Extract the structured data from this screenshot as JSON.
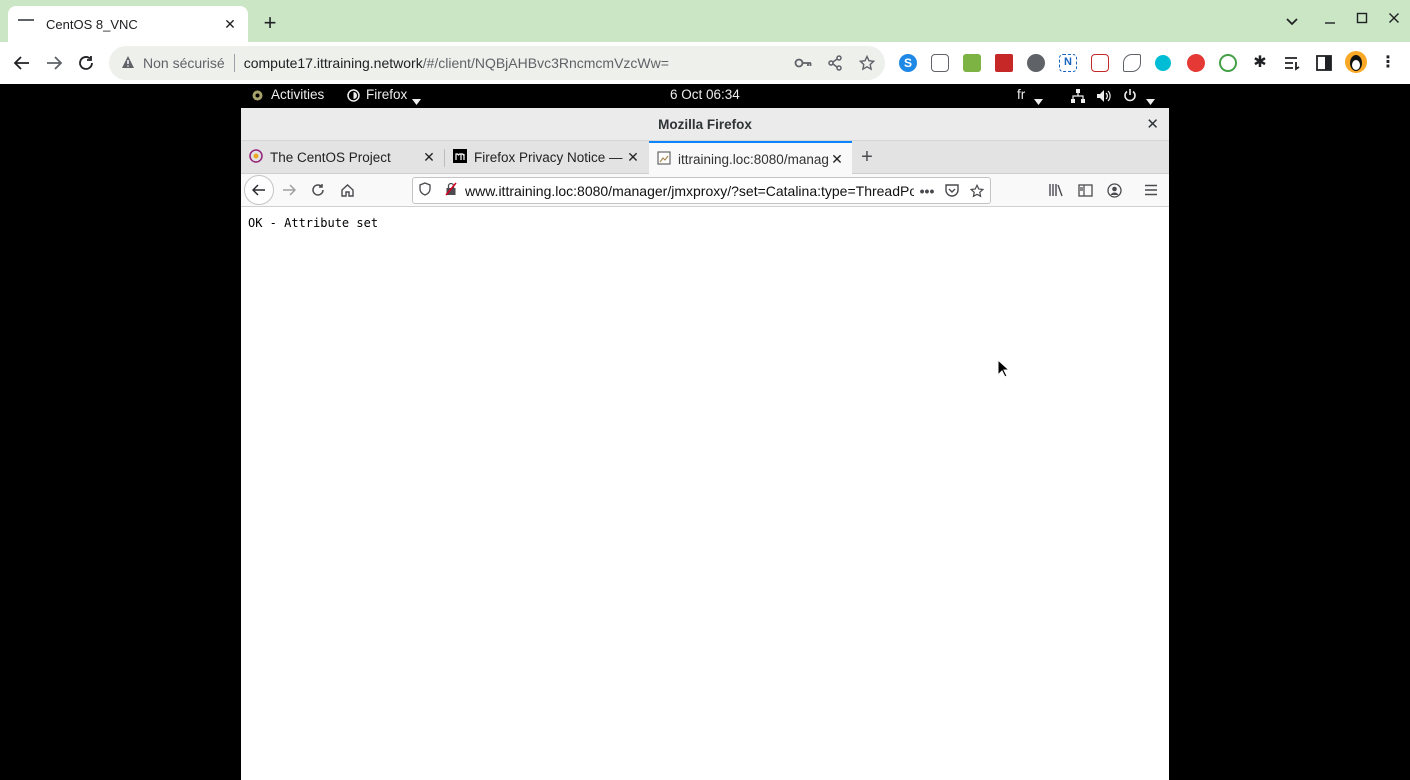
{
  "chrome": {
    "tab_title": "CentOS 8_VNC",
    "security_label": "Non sécurisé",
    "url_host": "compute17.ittraining.network",
    "url_path": "/#/client/NQBjAHBvc3RncmcmVzcWw="
  },
  "gnome": {
    "activities": "Activities",
    "app_menu": "Firefox",
    "clock": "6 Oct  06:34",
    "keyboard_layout": "fr"
  },
  "firefox": {
    "window_title": "Mozilla Firefox",
    "tabs": [
      {
        "label": "The CentOS Project",
        "icon": "centos-logo-icon"
      },
      {
        "label": "Firefox Privacy Notice —",
        "icon": "mozilla-logo-icon"
      },
      {
        "label": "ittraining.loc:8080/manag",
        "icon": "broken-image-icon"
      }
    ],
    "url": "www.ittraining.loc:8080/manager/jmxproxy/?set=Catalina:type=ThreadPo",
    "page_text": "OK - Attribute set"
  },
  "colors": {
    "chrome_frame": "#cbe6c5",
    "ff_active_tab_accent": "#0a84ff"
  }
}
